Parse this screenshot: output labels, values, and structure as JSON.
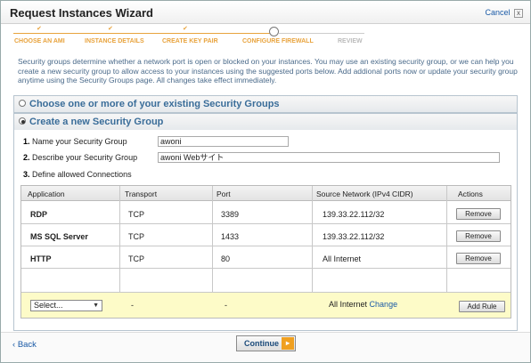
{
  "dialog": {
    "title": "Request Instances Wizard",
    "cancel_label": "Cancel",
    "close_glyph": "x"
  },
  "steps": [
    {
      "label": "CHOOSE AN AMI",
      "state": "done"
    },
    {
      "label": "INSTANCE DETAILS",
      "state": "done"
    },
    {
      "label": "CREATE KEY PAIR",
      "state": "done"
    },
    {
      "label": "CONFIGURE FIREWALL",
      "state": "current"
    },
    {
      "label": "REVIEW",
      "state": "future"
    }
  ],
  "description": "Security groups determine whether a network port is open or blocked on your instances. You may use an existing security group, or we can help you create a new security group to allow access to your instances using the suggested ports below. Add addional ports now or update your security group anytime using the Security Groups page. All changes take effect immediately.",
  "existing_panel": {
    "label": "Choose one or more of your existing Security Groups",
    "selected": false
  },
  "new_panel": {
    "label": "Create a new Security Group",
    "selected": true
  },
  "form": {
    "name_num": "1.",
    "name_label": "Name your Security Group",
    "name_value": "awoni",
    "describe_num": "2.",
    "describe_label": "Describe your Security Group",
    "describe_value": "awoni Webサイト",
    "define_num": "3.",
    "define_label": "Define allowed Connections"
  },
  "table": {
    "headers": [
      "Application",
      "Transport",
      "Port",
      "Source Network (IPv4 CIDR)",
      "Actions"
    ],
    "rows": [
      {
        "application": "RDP",
        "transport": "TCP",
        "port": "3389",
        "source": "139.33.22.112/32",
        "action": "Remove"
      },
      {
        "application": "MS SQL Server",
        "transport": "TCP",
        "port": "1433",
        "source": "139.33.22.112/32",
        "action": "Remove"
      },
      {
        "application": "HTTP",
        "transport": "TCP",
        "port": "80",
        "source": "All Internet",
        "action": "Remove"
      }
    ],
    "new_rule": {
      "select_value": "Select...",
      "transport": "-",
      "port": "-",
      "source": "All Internet",
      "change_label": "Change",
      "add_label": "Add Rule"
    }
  },
  "footer": {
    "back_label": "Back",
    "back_glyph": "‹",
    "continue_label": "Continue",
    "continue_glyph": "▸"
  },
  "colors": {
    "accent_orange": "#e8a33d",
    "link_blue": "#1a5aa6",
    "new_rule_bg": "#fdfbc8"
  }
}
